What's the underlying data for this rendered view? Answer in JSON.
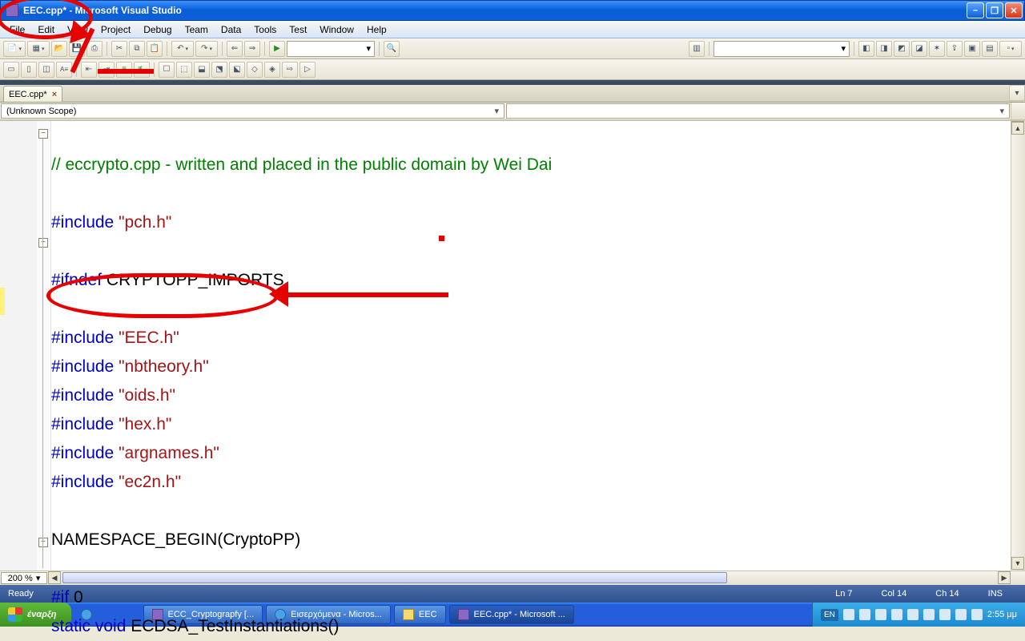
{
  "window": {
    "title": "EEC.cpp* - Microsoft Visual Studio"
  },
  "menu": [
    "File",
    "Edit",
    "View",
    "Project",
    "Debug",
    "Team",
    "Data",
    "Tools",
    "Test",
    "Window",
    "Help"
  ],
  "tab": {
    "label": "EEC.cpp*"
  },
  "scope": {
    "left": "(Unknown Scope)",
    "right": ""
  },
  "zoom": "200 %",
  "code": {
    "l1_comment": "// eccrypto.cpp - written and placed in the public domain by Wei Dai",
    "l2": "",
    "l3_pre": "#include ",
    "l3_str": "\"pch.h\"",
    "l4": "",
    "l5_pre": "#ifndef",
    "l5_id": " CRYPTOPP_IMPORTS",
    "l6": "",
    "l7_pre": "#include ",
    "l7_str": "\"EEC.h\"",
    "l8_pre": "#include ",
    "l8_str": "\"nbtheory.h\"",
    "l9_pre": "#include ",
    "l9_str": "\"oids.h\"",
    "l10_pre": "#include ",
    "l10_str": "\"hex.h\"",
    "l11_pre": "#include ",
    "l11_str": "\"argnames.h\"",
    "l12_pre": "#include ",
    "l12_str": "\"ec2n.h\"",
    "l13": "",
    "l14": "NAMESPACE_BEGIN(CryptoPP)",
    "l15": "",
    "l16_pre": "#if",
    "l16_id": " 0",
    "l17_kw": "static void",
    "l17_rest": " ECDSA_TestInstantiations()"
  },
  "status": {
    "ready": "Ready",
    "line": "Ln 7",
    "col": "Col 14",
    "ch": "Ch 14",
    "ins": "INS"
  },
  "taskbar": {
    "start": "έναρξη",
    "items": [
      {
        "label": "ECC_Cryptograpfy [...",
        "type": "vs"
      },
      {
        "label": "Εισερχόμενα - Micros...",
        "type": "ie"
      },
      {
        "label": "EEC",
        "type": "folder"
      },
      {
        "label": "EEC.cpp* - Microsoft ...",
        "type": "vs",
        "active": true
      }
    ]
  },
  "systray": {
    "lang": "EN",
    "time": "2:55 μμ"
  }
}
